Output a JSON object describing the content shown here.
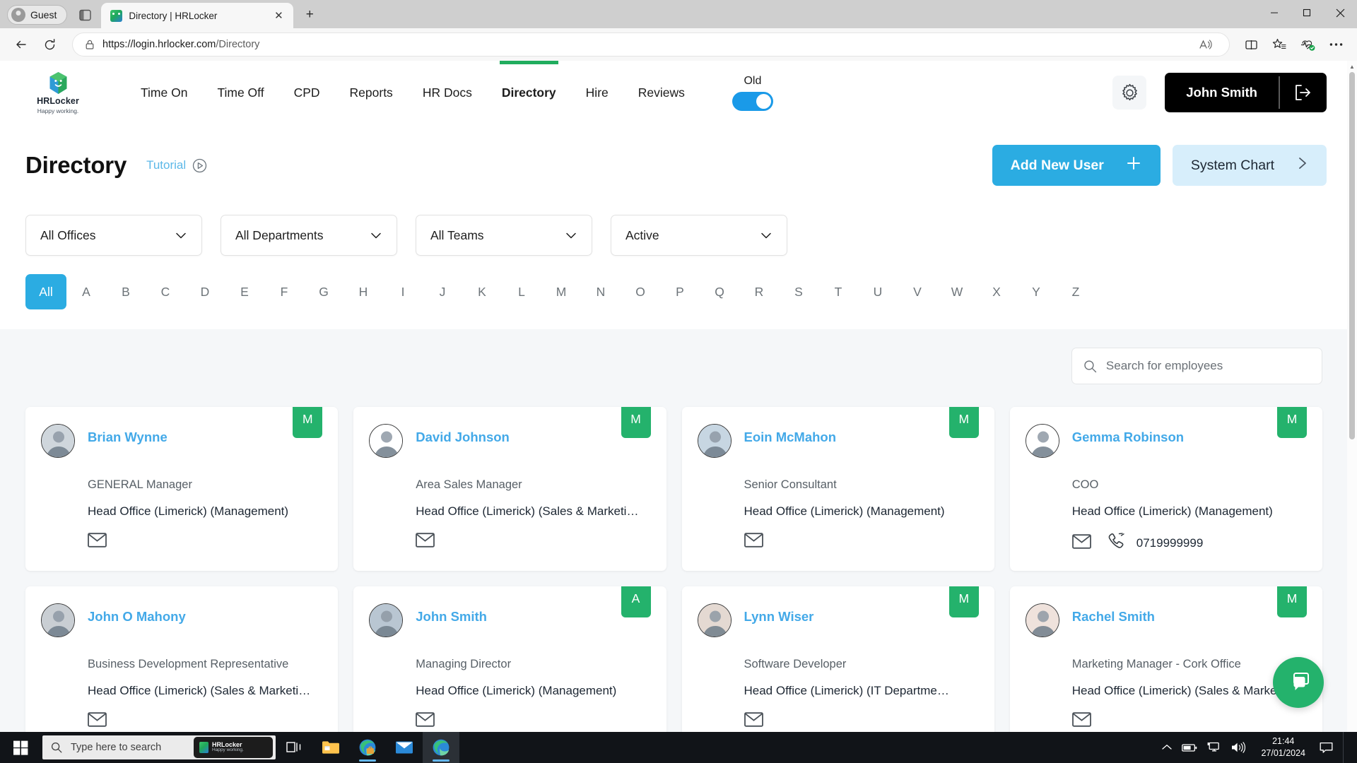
{
  "browser": {
    "profile_label": "Guest",
    "tab": {
      "title": "Directory | HRLocker",
      "close_label": "✕"
    },
    "new_tab_label": "+",
    "url_prefix": "https://login.hrlocker.com",
    "url_path": "/Directory",
    "window_controls": {
      "minimize": "─",
      "maximize": "☐",
      "close": "✕"
    }
  },
  "app": {
    "logo_name": "HRLocker",
    "logo_tagline": "Happy working.",
    "nav": [
      {
        "label": "Time On",
        "active": false
      },
      {
        "label": "Time Off",
        "active": false
      },
      {
        "label": "CPD",
        "active": false
      },
      {
        "label": "Reports",
        "active": false
      },
      {
        "label": "HR Docs",
        "active": false
      },
      {
        "label": "Directory",
        "active": true
      },
      {
        "label": "Hire",
        "active": false
      },
      {
        "label": "Reviews",
        "active": false
      }
    ],
    "version_toggle": {
      "label": "Old",
      "on": true
    },
    "user_name": "John Smith"
  },
  "page": {
    "title": "Directory",
    "tutorial_label": "Tutorial",
    "add_user_label": "Add New User",
    "add_user_icon": "+",
    "system_chart_label": "System Chart",
    "system_chart_icon": "›"
  },
  "filters": [
    {
      "name": "offices",
      "value": "All Offices"
    },
    {
      "name": "departments",
      "value": "All Departments"
    },
    {
      "name": "teams",
      "value": "All Teams"
    },
    {
      "name": "status",
      "value": "Active"
    }
  ],
  "alphabet": {
    "selected": "All",
    "items": [
      "All",
      "A",
      "B",
      "C",
      "D",
      "E",
      "F",
      "G",
      "H",
      "I",
      "J",
      "K",
      "L",
      "M",
      "N",
      "O",
      "P",
      "Q",
      "R",
      "S",
      "T",
      "U",
      "V",
      "W",
      "X",
      "Y",
      "Z"
    ]
  },
  "search": {
    "placeholder": "Search for employees",
    "value": ""
  },
  "employees": [
    {
      "name": "Brian Wynne",
      "role": "GENERAL Manager",
      "location": "Head Office (Limerick) (Management)",
      "badge": "M",
      "phone": "",
      "has_email": true,
      "avatar_tone": "#cfd6dc"
    },
    {
      "name": "David Johnson",
      "role": "Area Sales Manager",
      "location": "Head Office (Limerick) (Sales & Marketi…",
      "badge": "M",
      "phone": "",
      "has_email": true,
      "avatar_tone": "#ffffff"
    },
    {
      "name": "Eoin McMahon",
      "role": "Senior Consultant",
      "location": "Head Office (Limerick) (Management)",
      "badge": "M",
      "phone": "",
      "has_email": true,
      "avatar_tone": "#c7d6e2"
    },
    {
      "name": "Gemma Robinson",
      "role": "COO",
      "location": "Head Office (Limerick) (Management)",
      "badge": "M",
      "phone": "0719999999",
      "has_email": true,
      "avatar_tone": "#ffffff"
    },
    {
      "name": "John O Mahony",
      "role": "Business Development Representative",
      "location": "Head Office (Limerick) (Sales & Marketi…",
      "badge": "",
      "phone": "",
      "has_email": false,
      "avatar_tone": "#c9ced3"
    },
    {
      "name": "John Smith",
      "role": "Managing Director",
      "location": "Head Office (Limerick) (Management)",
      "badge": "A",
      "phone": "",
      "has_email": false,
      "avatar_tone": "#b9c6d2"
    },
    {
      "name": "Lynn Wiser",
      "role": "Software Developer",
      "location": "Head Office (Limerick) (IT Departme…",
      "badge": "M",
      "phone": "",
      "has_email": false,
      "avatar_tone": "#e4d9d2"
    },
    {
      "name": "Rachel Smith",
      "role": "Marketing Manager - Cork Office",
      "location": "Head Office (Limerick) (Sales & Marketi…",
      "badge": "M",
      "phone": "",
      "has_email": false,
      "avatar_tone": "#efe2dc"
    }
  ],
  "taskbar": {
    "search_placeholder": "Type here to search",
    "tooltip": {
      "title": "HRLocker",
      "subtitle": "Happy working."
    },
    "time": "21:44",
    "date": "27/01/2024"
  },
  "colors": {
    "accent_blue": "#2bace2",
    "link_blue": "#43a9e8",
    "badge_green": "#24b26c",
    "nav_active_green": "#21ad5e",
    "toggle_blue": "#1a9ae8",
    "secondary_blue": "#d7eefb"
  }
}
